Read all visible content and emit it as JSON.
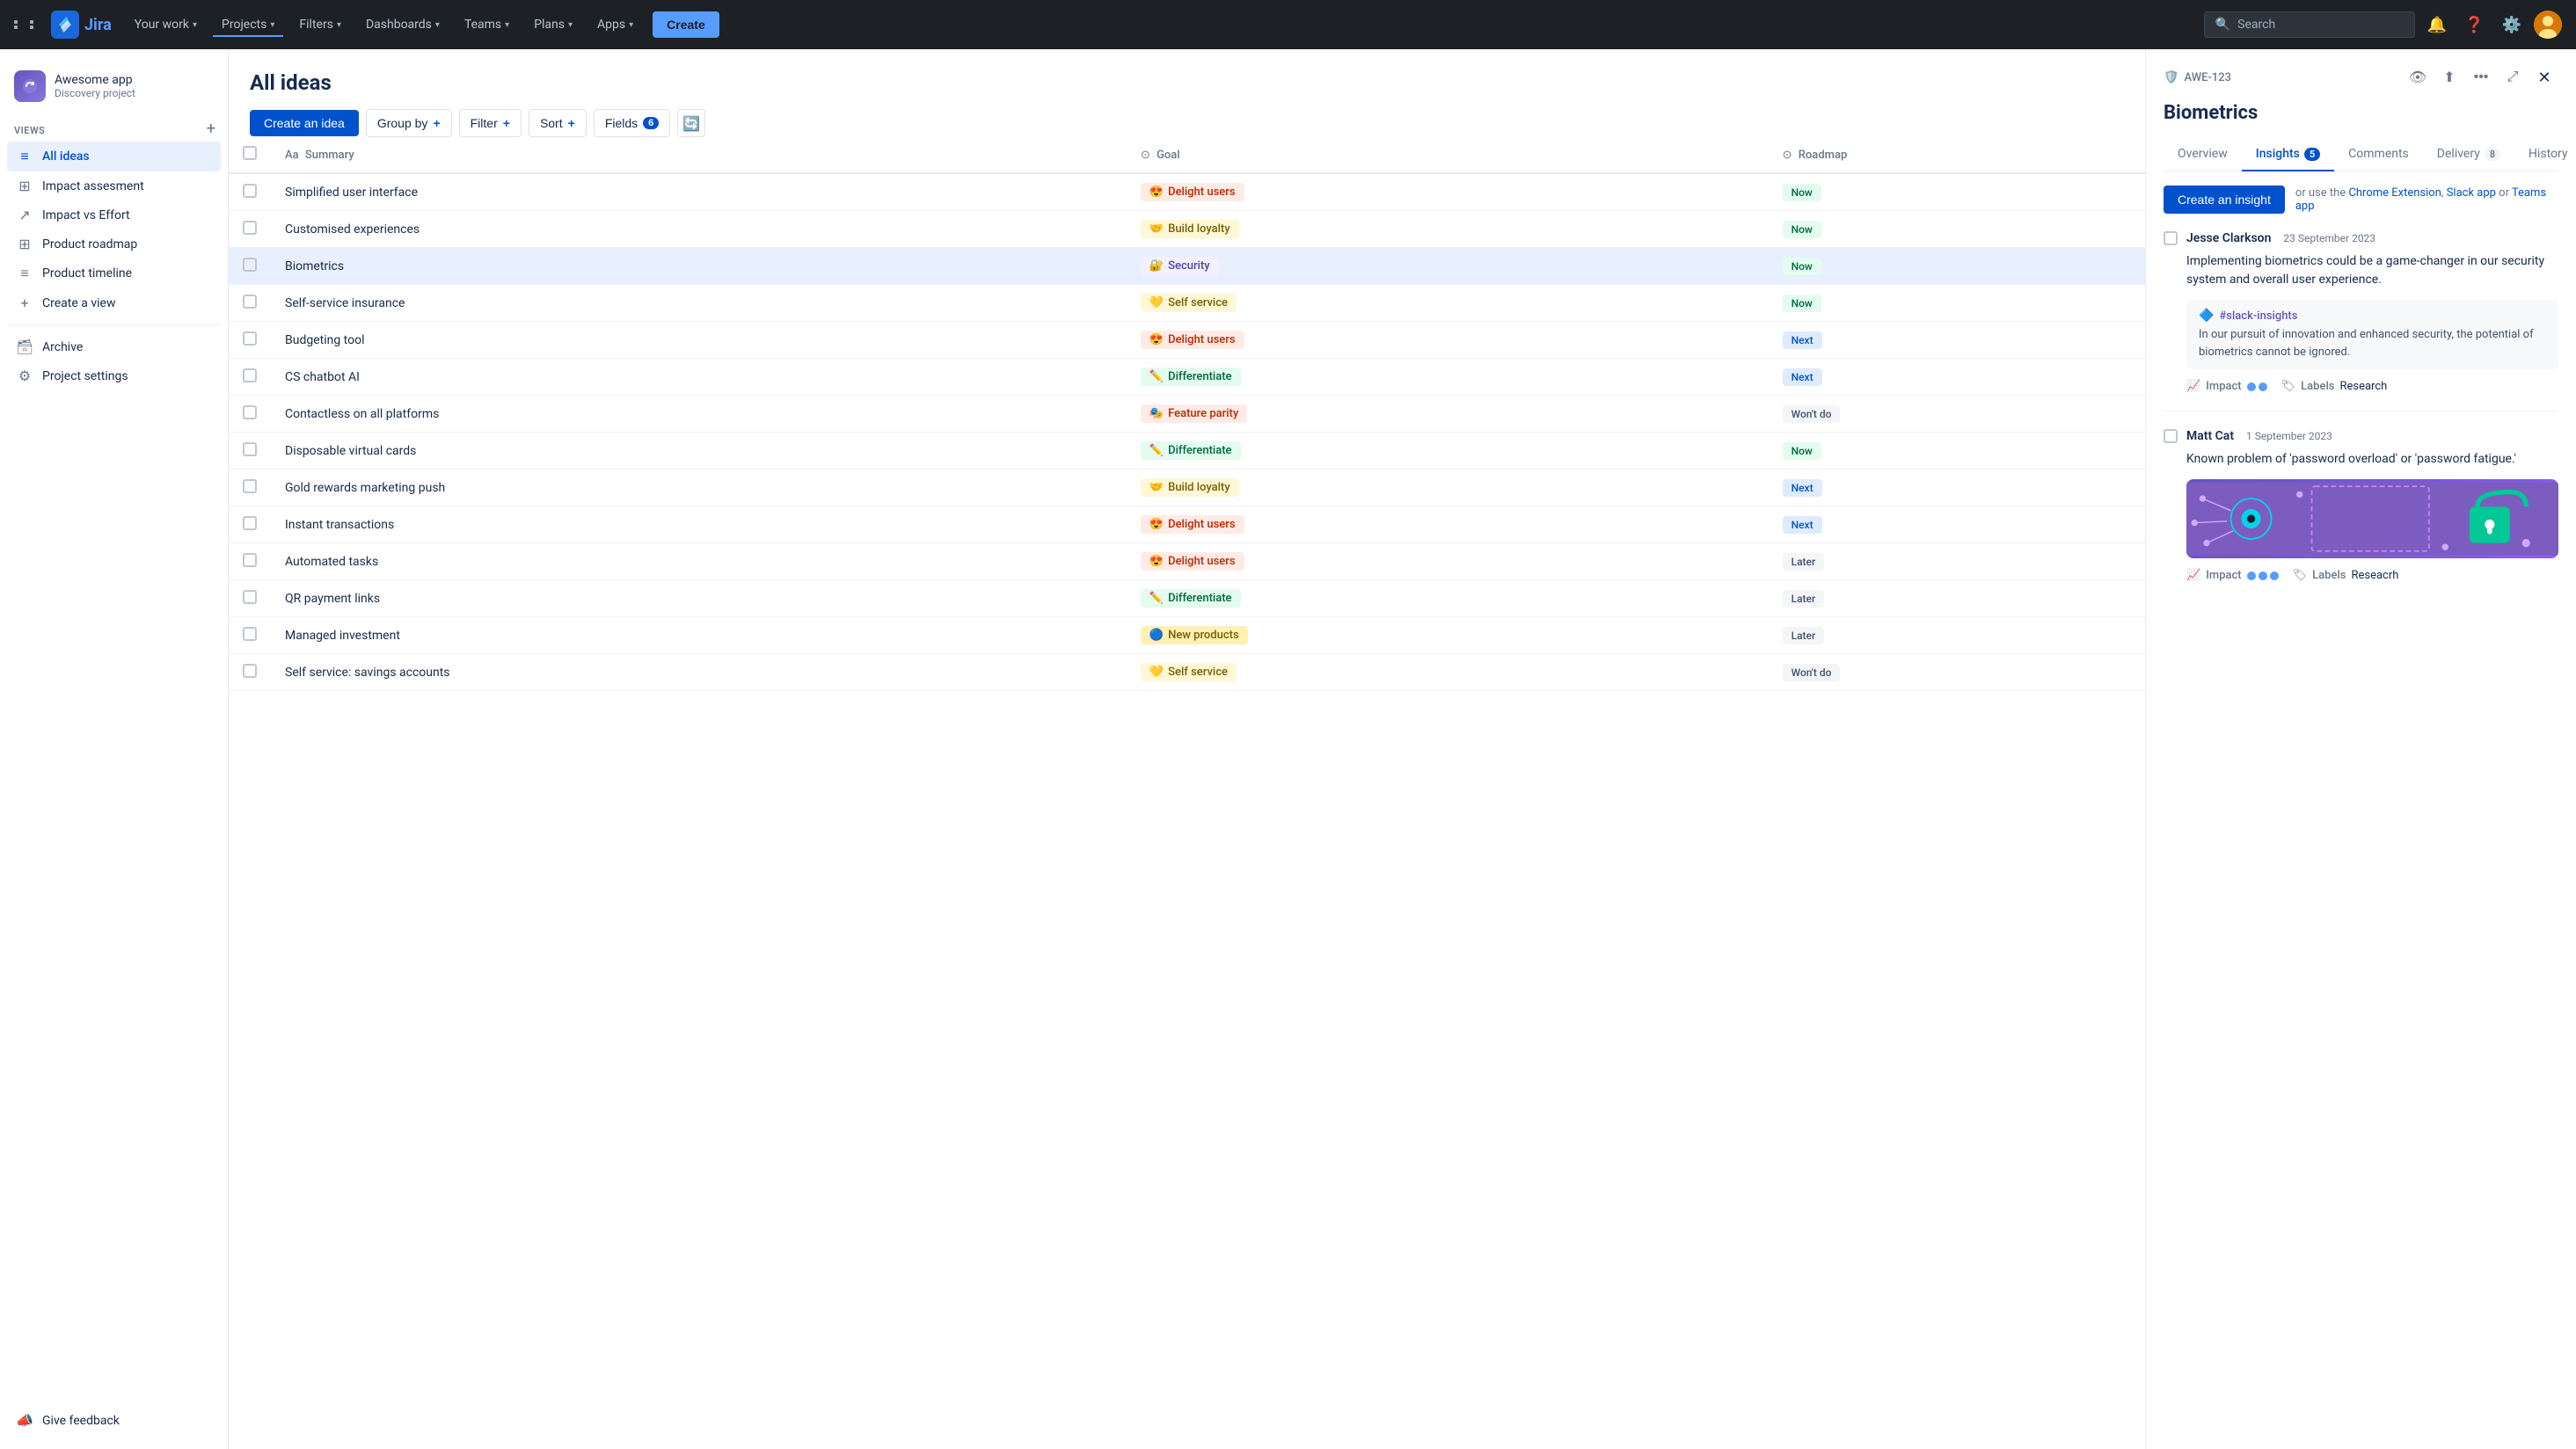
{
  "topnav": {
    "your_work": "Your work",
    "projects": "Projects",
    "filters": "Filters",
    "dashboards": "Dashboards",
    "teams": "Teams",
    "plans": "Plans",
    "apps": "Apps",
    "create": "Create",
    "search_placeholder": "Search"
  },
  "sidebar": {
    "project_name": "Awesome app",
    "project_type": "Discovery project",
    "views_label": "VIEWS",
    "items": [
      {
        "id": "all-ideas",
        "label": "All ideas",
        "icon": "≡",
        "active": true
      },
      {
        "id": "impact-assessment",
        "label": "Impact assesment",
        "icon": "⊞",
        "active": false
      },
      {
        "id": "impact-vs-effort",
        "label": "Impact vs Effort",
        "icon": "↗",
        "active": false
      },
      {
        "id": "product-roadmap",
        "label": "Product roadmap",
        "icon": "⊞",
        "active": false
      },
      {
        "id": "product-timeline",
        "label": "Product timeline",
        "icon": "≡",
        "active": false
      }
    ],
    "create_view": "Create a view",
    "archive": "Archive",
    "project_settings": "Project settings",
    "give_feedback": "Give feedback"
  },
  "main": {
    "title": "All ideas",
    "toolbar": {
      "create_idea": "Create an idea",
      "group_by": "Group by",
      "filter": "Filter",
      "sort": "Sort",
      "fields": "Fields",
      "fields_count": "6"
    },
    "table": {
      "headers": [
        "Summary",
        "Goal",
        "Roadmap"
      ],
      "rows": [
        {
          "id": 1,
          "summary": "Simplified user interface",
          "goal": "Delight users",
          "goal_class": "goal-delight",
          "goal_emoji": "😍",
          "roadmap": "Now",
          "roadmap_class": "roadmap-now"
        },
        {
          "id": 2,
          "summary": "Customised experiences",
          "goal": "Build loyalty",
          "goal_class": "goal-loyalty",
          "goal_emoji": "🤝",
          "roadmap": "Now",
          "roadmap_class": "roadmap-now"
        },
        {
          "id": 3,
          "summary": "Biometrics",
          "goal": "Security",
          "goal_class": "goal-security",
          "goal_emoji": "🔐",
          "roadmap": "Now",
          "roadmap_class": "roadmap-now",
          "selected": true
        },
        {
          "id": 4,
          "summary": "Self-service insurance",
          "goal": "Self service",
          "goal_class": "goal-self",
          "goal_emoji": "💛",
          "roadmap": "Now",
          "roadmap_class": "roadmap-now"
        },
        {
          "id": 5,
          "summary": "Budgeting tool",
          "goal": "Delight users",
          "goal_class": "goal-delight",
          "goal_emoji": "😍",
          "roadmap": "Next",
          "roadmap_class": "roadmap-next"
        },
        {
          "id": 6,
          "summary": "CS chatbot AI",
          "goal": "Differentiate",
          "goal_class": "goal-differentiate",
          "goal_emoji": "✏️",
          "roadmap": "Next",
          "roadmap_class": "roadmap-next"
        },
        {
          "id": 7,
          "summary": "Contactless on all platforms",
          "goal": "Feature parity",
          "goal_class": "goal-parity",
          "goal_emoji": "🎭",
          "roadmap": "Won't do",
          "roadmap_class": "roadmap-wontdo"
        },
        {
          "id": 8,
          "summary": "Disposable virtual cards",
          "goal": "Differentiate",
          "goal_class": "goal-differentiate",
          "goal_emoji": "✏️",
          "roadmap": "Now",
          "roadmap_class": "roadmap-now"
        },
        {
          "id": 9,
          "summary": "Gold rewards marketing push",
          "goal": "Build loyalty",
          "goal_class": "goal-loyalty",
          "goal_emoji": "🤝",
          "roadmap": "Next",
          "roadmap_class": "roadmap-next"
        },
        {
          "id": 10,
          "summary": "Instant transactions",
          "goal": "Delight users",
          "goal_class": "goal-delight",
          "goal_emoji": "😍",
          "roadmap": "Next",
          "roadmap_class": "roadmap-next"
        },
        {
          "id": 11,
          "summary": "Automated tasks",
          "goal": "Delight users",
          "goal_class": "goal-delight",
          "goal_emoji": "😍",
          "roadmap": "Later",
          "roadmap_class": "roadmap-later"
        },
        {
          "id": 12,
          "summary": "QR payment links",
          "goal": "Differentiate",
          "goal_class": "goal-differentiate",
          "goal_emoji": "✏️",
          "roadmap": "Later",
          "roadmap_class": "roadmap-later"
        },
        {
          "id": 13,
          "summary": "Managed investment",
          "goal": "New products",
          "goal_class": "goal-new",
          "goal_emoji": "🔵",
          "roadmap": "Later",
          "roadmap_class": "roadmap-later"
        },
        {
          "id": 14,
          "summary": "Self service: savings accounts",
          "goal": "Self service",
          "goal_class": "goal-self",
          "goal_emoji": "💛",
          "roadmap": "Won't do",
          "roadmap_class": "roadmap-wontdo"
        }
      ]
    }
  },
  "detail": {
    "id": "AWE-123",
    "title": "Biometrics",
    "tabs": [
      {
        "id": "overview",
        "label": "Overview",
        "badge": null
      },
      {
        "id": "insights",
        "label": "Insights",
        "badge": "5",
        "active": true
      },
      {
        "id": "comments",
        "label": "Comments",
        "badge": null
      },
      {
        "id": "delivery",
        "label": "Delivery",
        "badge": "8"
      },
      {
        "id": "history",
        "label": "History",
        "badge": null
      }
    ],
    "insights": {
      "create_btn": "Create an insight",
      "hint": "or use the",
      "chrome_ext": "Chrome Extension",
      "slack_app": "Slack app",
      "teams_app": "Teams app",
      "items": [
        {
          "author": "Jesse Clarkson",
          "date": "23 September 2023",
          "text": "Implementing biometrics could be a game-changer in our security system and overall user experience.",
          "source_tag": "#slack-insights",
          "source_text": "In our pursuit of innovation and enhanced security, the potential of biometrics cannot be ignored.",
          "impact_dots": 2,
          "labels": "Research",
          "has_image": false
        },
        {
          "author": "Matt Cat",
          "date": "1 September 2023",
          "text": "Known problem of 'password overload' or 'password fatigue.'",
          "source_tag": null,
          "source_text": null,
          "impact_dots": 3,
          "labels": "Reseacrh",
          "has_image": true
        }
      ]
    }
  }
}
